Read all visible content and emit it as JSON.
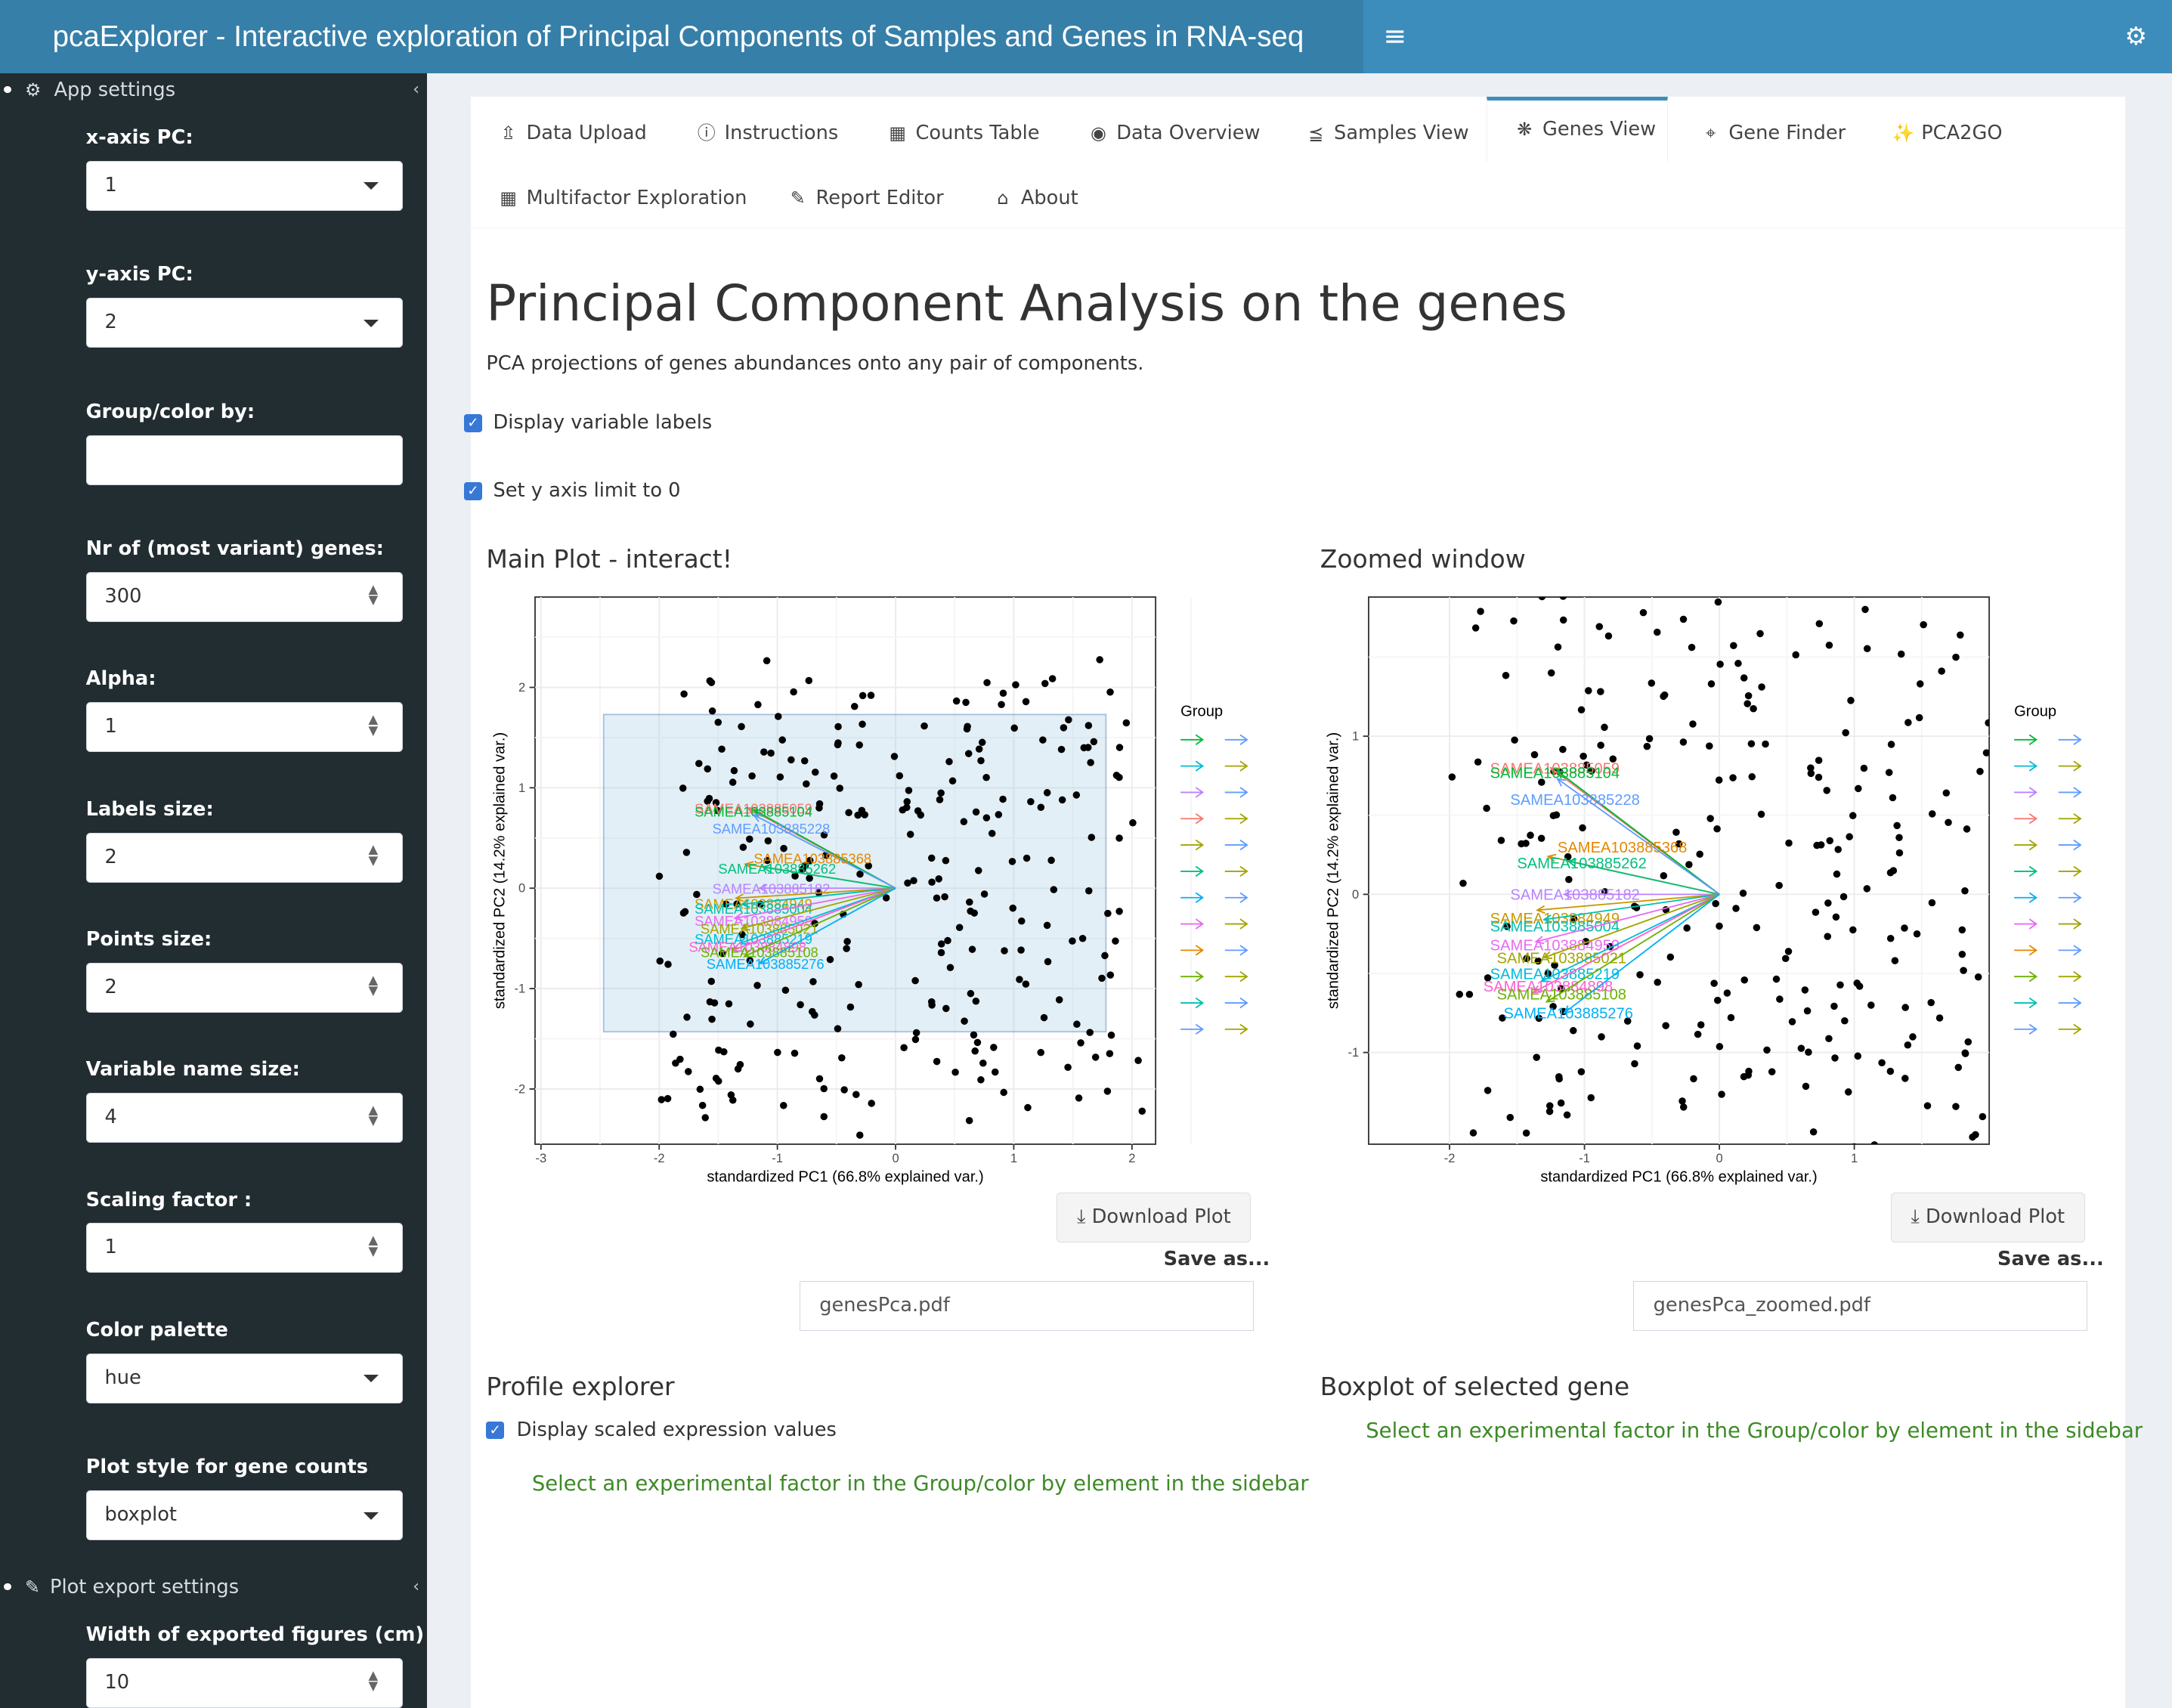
{
  "header": {
    "title": "pcaExplorer - Interactive exploration of Principal Components of Samples and Genes in RNA-seq"
  },
  "sidebar": {
    "app_settings": "App settings",
    "plot_export_settings": "Plot export settings",
    "fields": [
      {
        "label": "x-axis PC:",
        "value": "1",
        "kind": "select"
      },
      {
        "label": "y-axis PC:",
        "value": "2",
        "kind": "select"
      },
      {
        "label": "Group/color by:",
        "value": "",
        "kind": "text"
      },
      {
        "label": "Nr of (most variant) genes:",
        "value": "300",
        "kind": "number"
      },
      {
        "label": "Alpha:",
        "value": "1",
        "kind": "number"
      },
      {
        "label": "Labels size:",
        "value": "2",
        "kind": "number"
      },
      {
        "label": "Points size:",
        "value": "2",
        "kind": "number"
      },
      {
        "label": "Variable name size:",
        "value": "4",
        "kind": "number"
      },
      {
        "label": "Scaling factor :",
        "value": "1",
        "kind": "number"
      },
      {
        "label": "Color palette",
        "value": "hue",
        "kind": "select"
      },
      {
        "label": "Plot style for gene counts",
        "value": "boxplot",
        "kind": "select"
      }
    ],
    "export_fields": [
      {
        "label": "Width of exported figures (cm)",
        "value": "10",
        "kind": "number"
      }
    ]
  },
  "tabs": [
    {
      "label": "Data Upload",
      "icon": "upload-icon"
    },
    {
      "label": "Instructions",
      "icon": "info-icon"
    },
    {
      "label": "Counts Table",
      "icon": "table-icon"
    },
    {
      "label": "Data Overview",
      "icon": "eye-icon"
    },
    {
      "label": "Samples View",
      "icon": "share-icon"
    },
    {
      "label": "Genes View",
      "icon": "spinner-icon",
      "active": true
    },
    {
      "label": "Gene Finder",
      "icon": "crosshairs-icon"
    },
    {
      "label": "PCA2GO",
      "icon": "magic-icon"
    },
    {
      "label": "Multifactor Exploration",
      "icon": "th-large-icon"
    },
    {
      "label": "Report Editor",
      "icon": "pencil-icon"
    },
    {
      "label": "About",
      "icon": "institution-icon"
    }
  ],
  "page": {
    "title": "Principal Component Analysis on the genes",
    "subtitle": "PCA projections of genes abundances onto any pair of components.",
    "cb_variable_labels": "Display variable labels",
    "cb_y_limit": "Set y axis limit to 0",
    "main_plot_title": "Main Plot - interact!",
    "zoom_plot_title": "Zoomed window",
    "download_label": "Download Plot",
    "save_as": "Save as...",
    "main_filename": "genesPca.pdf",
    "zoom_filename": "genesPca_zoomed.pdf",
    "profile_title": "Profile explorer",
    "cb_scaled": "Display scaled expression values",
    "boxplot_title": "Boxplot of selected gene",
    "hint": "Select an experimental factor in the Group/color by element in the sidebar"
  },
  "chart_data": [
    {
      "type": "scatter",
      "title": "",
      "xlabel": "standardized PC1 (66.8% explained var.)",
      "ylabel": "standardized PC2 (14.2% explained var.)",
      "xticks": [
        "-3",
        "-2",
        "-1",
        "0",
        "1",
        "2"
      ],
      "yticks": [
        "2",
        "1",
        "0",
        "-1",
        "-2"
      ],
      "xlim": [
        -3.05,
        2.2
      ],
      "ylim": [
        -2.55,
        2.9
      ],
      "legend_title": "Group",
      "brush": {
        "x0": -2.47,
        "x1": 1.78,
        "y0": -1.43,
        "y1": 1.73
      },
      "variable_labels": [
        "SAMEA103885059",
        "SAMEA103885104",
        "SAMEA103885228",
        "SAMEA103885368",
        "SAMEA103885262",
        "SAMEA103885182",
        "SAMEA103884949",
        "SAMEA103885004",
        "SAMEA103884959",
        "SAMEA103885021",
        "SAMEA103885219",
        "SAMEA103884898",
        "SAMEA103885108",
        "SAMEA103885276"
      ]
    },
    {
      "type": "scatter",
      "title": "",
      "xlabel": "standardized PC1 (66.8% explained var.)",
      "ylabel": "standardized PC2 (14.2% explained var.)",
      "xticks": [
        "-2",
        "-1",
        "0",
        "1"
      ],
      "yticks": [
        "1",
        "0",
        "-1"
      ],
      "xlim": [
        -2.6,
        2.0
      ],
      "ylim": [
        -1.58,
        1.88
      ],
      "legend_title": "Group",
      "variable_labels": [
        "SAMEA103885059",
        "SAMEA103885104",
        "SAMEA103885228",
        "SAMEA103885368",
        "SAMEA103885262",
        "SAMEA103885182",
        "SAMEA103884949",
        "SAMEA103885004",
        "SAMEA103884959",
        "SAMEA103885021",
        "SAMEA103885219",
        "SAMEA103884898",
        "SAMEA103885108",
        "SAMEA103885276"
      ]
    }
  ]
}
